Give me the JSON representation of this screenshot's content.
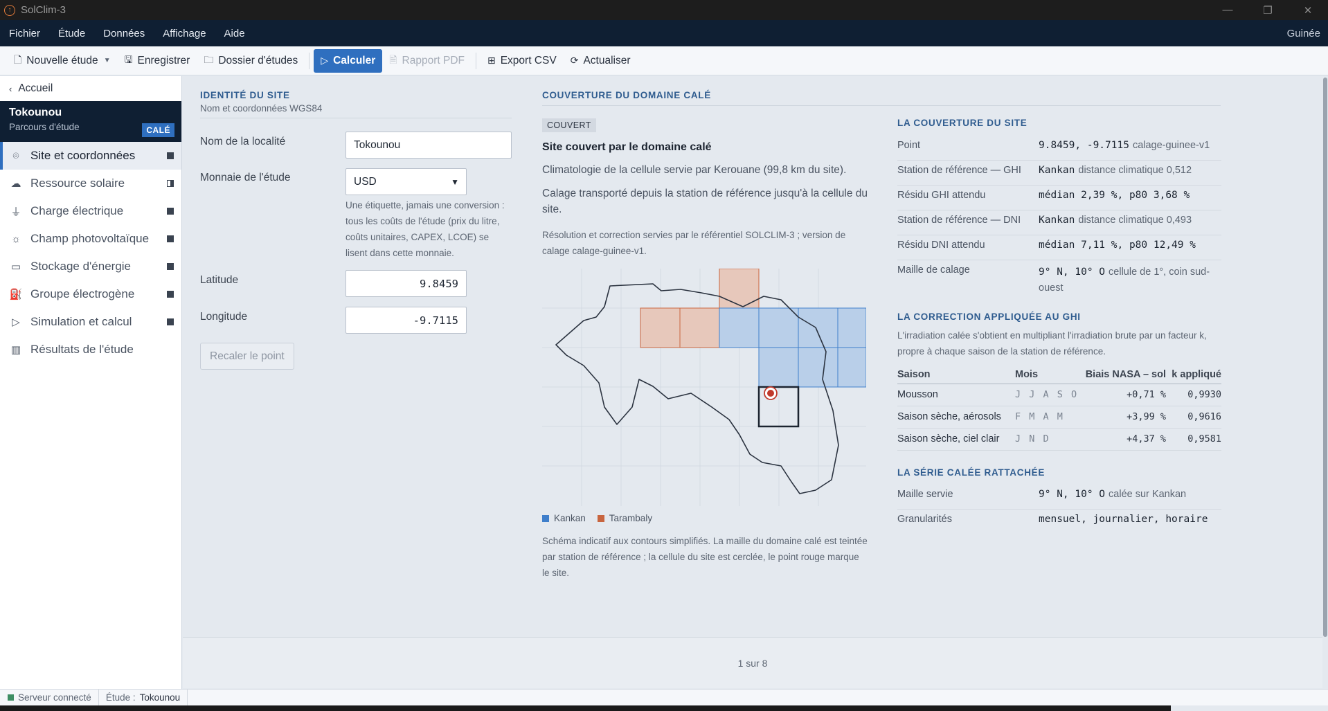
{
  "window": {
    "title": "SolClim-3",
    "controls": [
      "—",
      "❐",
      "✕"
    ]
  },
  "menu": {
    "items": [
      "Fichier",
      "Étude",
      "Données",
      "Affichage",
      "Aide"
    ],
    "region": "Guinée"
  },
  "toolbar": {
    "new_study": "Nouvelle étude",
    "save": "Enregistrer",
    "folder": "Dossier d'études",
    "compute": "Calculer",
    "pdf": "Rapport PDF",
    "csv": "Export CSV",
    "refresh": "Actualiser"
  },
  "sidebar": {
    "back": "Accueil",
    "study_name": "Tokounou",
    "study_sub": "Parcours d'étude",
    "badge": "CALÉ",
    "items": [
      {
        "label": "Site et coordonnées",
        "icon": "location-pin-icon",
        "state": "done"
      },
      {
        "label": "Ressource solaire",
        "icon": "sun-cloud-icon",
        "state": "partial"
      },
      {
        "label": "Charge électrique",
        "icon": "plug-icon",
        "state": "done"
      },
      {
        "label": "Champ photovoltaïque",
        "icon": "sun-icon",
        "state": "done"
      },
      {
        "label": "Stockage d'énergie",
        "icon": "battery-icon",
        "state": "done"
      },
      {
        "label": "Groupe électrogène",
        "icon": "generator-icon",
        "state": "done"
      },
      {
        "label": "Simulation et calcul",
        "icon": "play-icon",
        "state": "done"
      },
      {
        "label": "Résultats de l'étude",
        "icon": "bar-chart-icon",
        "state": "none"
      }
    ]
  },
  "identity": {
    "heading": "IDENTITÉ DU SITE",
    "subheading": "Nom et coordonnées WGS84",
    "locality_label": "Nom de la localité",
    "locality_value": "Tokounou",
    "currency_label": "Monnaie de l'étude",
    "currency_value": "USD",
    "currency_hint": "Une étiquette, jamais une conversion : tous les coûts de l'étude (prix du litre, coûts unitaires, CAPEX, LCOE) se lisent dans cette monnaie.",
    "lat_label": "Latitude",
    "lat_value": "9.8459",
    "lon_label": "Longitude",
    "lon_value": "-9.7115",
    "recal": "Recaler le point"
  },
  "coverage": {
    "heading": "COUVERTURE DU DOMAINE CALÉ",
    "tag": "COUVERT",
    "title": "Site couvert par le domaine calé",
    "p1": "Climatologie de la cellule servie par Kerouane (99,8 km du site).",
    "p2": "Calage transporté depuis la station de référence jusqu'à la cellule du site.",
    "p3": "Résolution et correction servies par le référentiel SOLCLIM-3 ; version de calage calage-guinee-v1.",
    "legend": [
      {
        "label": "Kankan",
        "color": "#3f7fcb"
      },
      {
        "label": "Tarambaly",
        "color": "#c8653f"
      }
    ],
    "caption": "Schéma indicatif aux contours simplifiés. La maille du domaine calé est teintée par station de référence ; la cellule du site est cerclée, le point rouge marque le site."
  },
  "site_coverage": {
    "heading": "LA COUVERTURE DU SITE",
    "rows": [
      {
        "k": "Point",
        "v": "9.8459, -9.7115",
        "x": "calage-guinee-v1"
      },
      {
        "k": "Station de référence — GHI",
        "v": "Kankan",
        "x": "distance climatique 0,512"
      },
      {
        "k": "Résidu GHI attendu",
        "v": "médian 2,39 %, p80 3,68 %",
        "x": ""
      },
      {
        "k": "Station de référence — DNI",
        "v": "Kankan",
        "x": "distance climatique 0,493"
      },
      {
        "k": "Résidu DNI attendu",
        "v": "médian 7,11 %, p80 12,49 %",
        "x": ""
      },
      {
        "k": "Maille de calage",
        "v": "9° N, 10° O",
        "x": "cellule de 1°, coin sud-ouest"
      }
    ]
  },
  "correction": {
    "heading": "LA CORRECTION APPLIQUÉE AU GHI",
    "desc": "L'irradiation calée s'obtient en multipliant l'irradiation brute par un facteur k, propre à chaque saison de la station de référence.",
    "columns": [
      "Saison",
      "Mois",
      "Biais NASA – sol",
      "k appliqué"
    ],
    "rows": [
      {
        "season": "Mousson",
        "months": "J J A S O",
        "bias": "+0,71 %",
        "k": "0,9930"
      },
      {
        "season": "Saison sèche, aérosols",
        "months": "F M A M",
        "bias": "+3,99 %",
        "k": "0,9616"
      },
      {
        "season": "Saison sèche, ciel clair",
        "months": "J N D",
        "bias": "+4,37 %",
        "k": "0,9581"
      }
    ]
  },
  "series": {
    "heading": "LA SÉRIE CALÉE RATTACHÉE",
    "rows": [
      {
        "k": "Maille servie",
        "v": "9° N, 10° O",
        "x": "calée sur Kankan"
      },
      {
        "k": "Granularités",
        "v": "mensuel, journalier, horaire",
        "x": ""
      }
    ]
  },
  "pager": "1 sur 8",
  "status": {
    "server": "Serveur connecté",
    "study_label": "Étude :",
    "study_value": "Tokounou"
  }
}
